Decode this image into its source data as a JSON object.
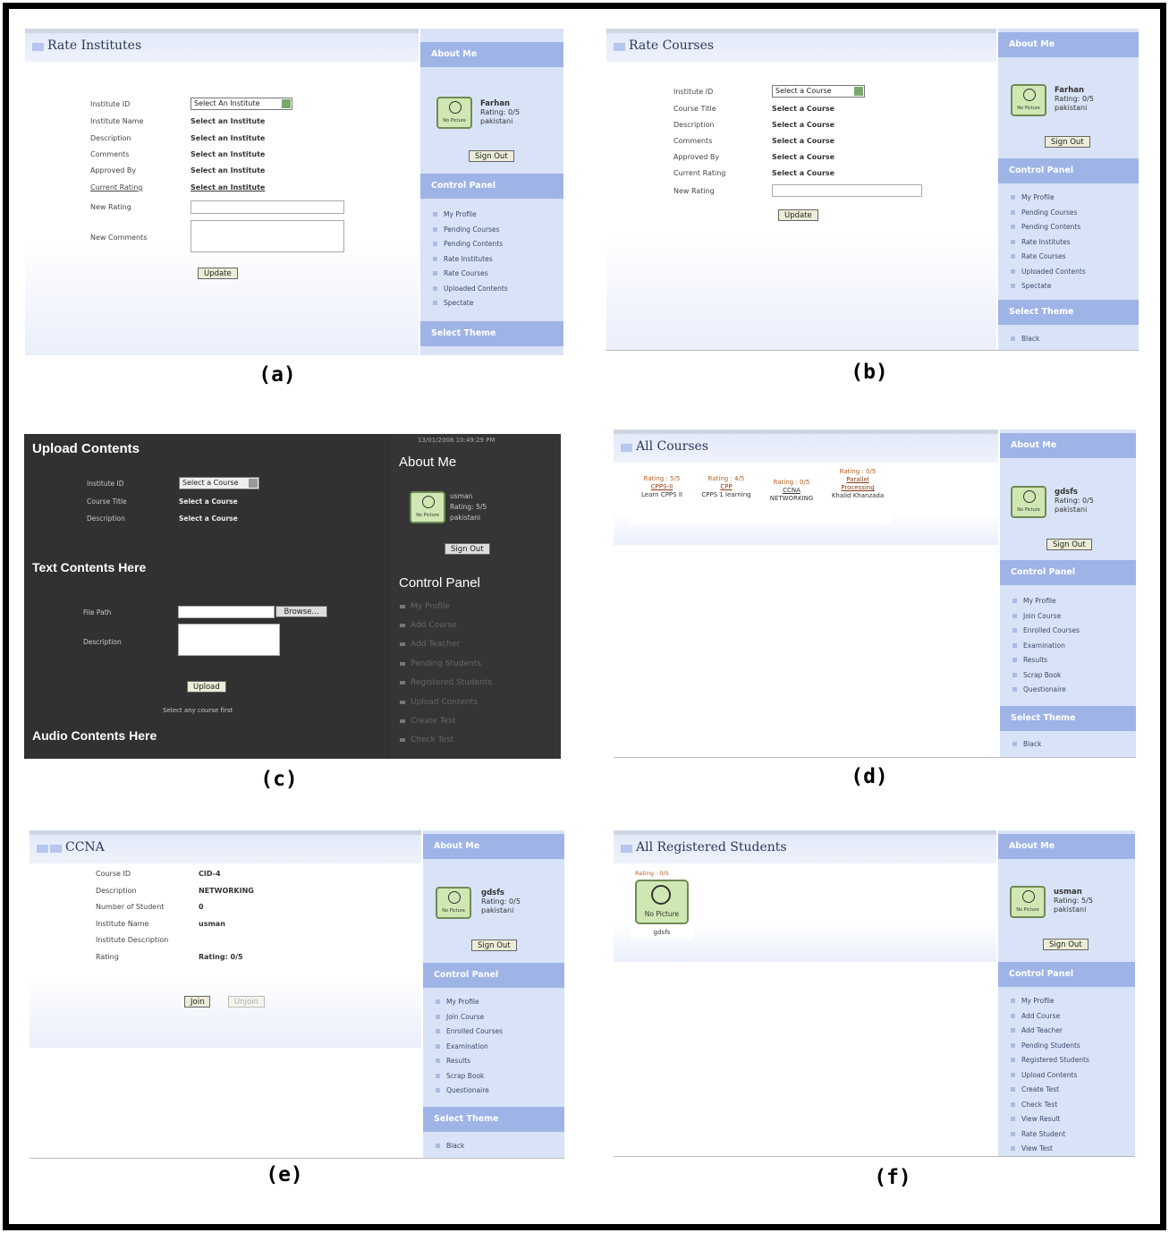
{
  "panels": {
    "a": {
      "caption": "(a)",
      "title": "Rate Institutes",
      "form": {
        "labels": [
          "Institute ID",
          "Institute Name",
          "Description",
          "Comments",
          "Approved By",
          "Current Rating",
          "New Rating",
          "New Comments"
        ],
        "select_value": "Select An Institute",
        "values": [
          "Select an Institute",
          "Select an Institute",
          "Select an Institute",
          "Select an Institute",
          "Select an Institute"
        ],
        "update_label": "Update"
      },
      "side": {
        "about": "About Me",
        "no_picture": "No Picture",
        "user": "Farhan",
        "rating": "Rating: 0/5",
        "country": "pakistani",
        "signout": "Sign Out",
        "control_panel": "Control Panel",
        "menu": [
          "My Profile",
          "Pending Courses",
          "Pending Contents",
          "Rate Institutes",
          "Rate Courses",
          "Uploaded Contents",
          "Spectate"
        ],
        "select_theme": "Select Theme"
      }
    },
    "b": {
      "caption": "(b)",
      "title": "Rate Courses",
      "form": {
        "labels": [
          "Institute ID",
          "Course Title",
          "Description",
          "Comments",
          "Approved By",
          "Current Rating",
          "New Rating"
        ],
        "select_value": "Select a Course",
        "values": [
          "Select a Course",
          "Select a Course",
          "Select a Course",
          "Select a Course",
          "Select a Course"
        ],
        "update_label": "Update"
      },
      "side": {
        "about": "About Me",
        "no_picture": "No Picture",
        "user": "Farhan",
        "rating": "Rating: 0/5",
        "country": "pakistani",
        "signout": "Sign Out",
        "control_panel": "Control Panel",
        "menu": [
          "My Profile",
          "Pending Courses",
          "Pending Contents",
          "Rate Institutes",
          "Rate Courses",
          "Uploaded Contents",
          "Spectate"
        ],
        "select_theme": "Select Theme",
        "themes": [
          "Black"
        ]
      }
    },
    "c": {
      "caption": "(c)",
      "timestamp": "13/01/2008 10:49:29 PM",
      "upload_title": "Upload Contents",
      "labels": [
        "Institute ID",
        "Course Title",
        "Description"
      ],
      "select_value": "Select a Course",
      "values": [
        "Select a Course",
        "Select a Course"
      ],
      "text_title": "Text Contents Here",
      "file_path": "File Path",
      "browse": "Browse...",
      "description": "Description",
      "upload": "Upload",
      "note": "Select any course first",
      "audio_title": "Audio Contents Here",
      "side": {
        "about": "About Me",
        "no_picture": "No Picture",
        "user": "usman",
        "rating": "Rating: 5/5",
        "country": "pakistani",
        "signout": "Sign Out",
        "control_panel": "Control Panel",
        "menu": [
          "My Profile",
          "Add Course",
          "Add Teacher",
          "Pending Students",
          "Registered Students",
          "Upload Contents",
          "Create Test",
          "Check Test"
        ]
      }
    },
    "d": {
      "caption": "(d)",
      "title": "All Courses",
      "courses": [
        {
          "rating": "Rating : 5/5",
          "name": "CPPS-II",
          "desc": "Learn CPPS II"
        },
        {
          "rating": "Rating : 4/5",
          "name": "CPP",
          "desc": "CPPS 1 learning"
        },
        {
          "rating": "Rating : 0/5",
          "name": "CCNA",
          "desc": "NETWORKING"
        },
        {
          "rating": "Rating : 0/5",
          "name": "Parallel Processing",
          "desc": "Khalid Khanzada"
        }
      ],
      "side": {
        "about": "About Me",
        "no_picture": "No Picture",
        "user": "gdsfs",
        "rating": "Rating: 0/5",
        "country": "pakistani",
        "signout": "Sign Out",
        "control_panel": "Control Panel",
        "menu": [
          "My Profile",
          "Join Course",
          "Enrolled Courses",
          "Examination",
          "Results",
          "Scrap Book",
          "Questionaire"
        ],
        "select_theme": "Select Theme",
        "themes": [
          "Black"
        ]
      }
    },
    "e": {
      "caption": "(e)",
      "title": "CCNA",
      "labels": [
        "Course ID",
        "Description",
        "Number of Student",
        "Institute Name",
        "Institute Description",
        "Rating"
      ],
      "values": [
        "CID-4",
        "NETWORKING",
        "0",
        "usman",
        "",
        "Rating: 0/5"
      ],
      "join": "Join",
      "unjoin": "Unjoin",
      "side": {
        "about": "About Me",
        "no_picture": "No Picture",
        "user": "gdsfs",
        "rating": "Rating: 0/5",
        "country": "pakistani",
        "signout": "Sign Out",
        "control_panel": "Control Panel",
        "menu": [
          "My Profile",
          "Join Course",
          "Enrolled Courses",
          "Examination",
          "Results",
          "Scrap Book",
          "Questionaire"
        ],
        "select_theme": "Select Theme",
        "themes": [
          "Black"
        ]
      }
    },
    "f": {
      "caption": "(f)",
      "title": "All Registered Students",
      "student": {
        "rating": "Rating : 0/5",
        "no_picture": "No Picture",
        "name": "gdsfs"
      },
      "side": {
        "about": "About Me",
        "no_picture": "No Picture",
        "user": "usman",
        "rating": "Rating: 5/5",
        "country": "pakistani",
        "signout": "Sign Out",
        "control_panel": "Control Panel",
        "menu": [
          "My Profile",
          "Add Course",
          "Add Teacher",
          "Pending Students",
          "Registered Students",
          "Upload Contents",
          "Create Test",
          "Check Test",
          "View Result",
          "Rate Student",
          "View Test"
        ]
      }
    }
  }
}
